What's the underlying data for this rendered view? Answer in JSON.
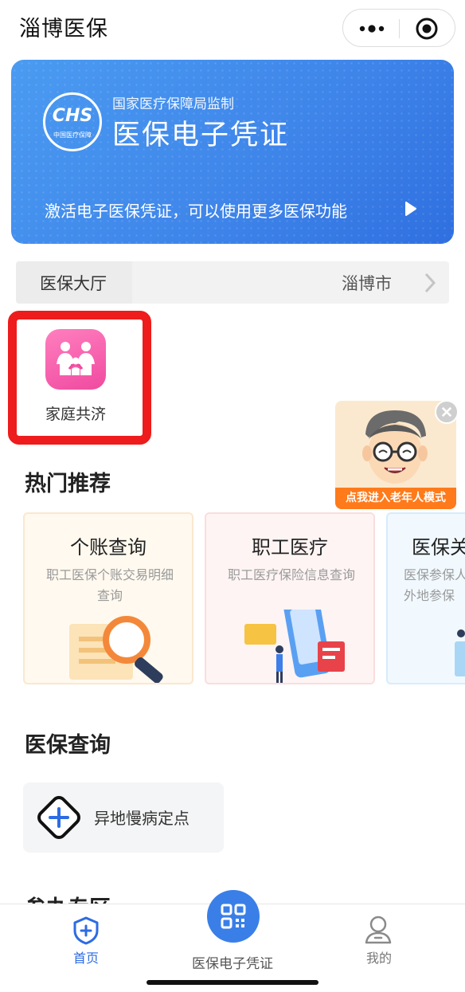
{
  "header": {
    "title": "淄博医保",
    "more_icon": "more-dots-icon",
    "target_icon": "record-target-icon"
  },
  "card": {
    "logo_text": "CHS",
    "logo_subtext": "中国医疗保障",
    "subtitle": "国家医疗保障局监制",
    "title": "医保电子凭证",
    "note": "激活电子医保凭证，可以使用更多医保功能",
    "accent": "#3f86ea"
  },
  "hall": {
    "label": "医保大厅",
    "city": "淄博市"
  },
  "family": {
    "label": "家庭共济",
    "icon": "family-icon",
    "highlight_color": "#ee1c1c"
  },
  "elder_mode": {
    "label": "点我进入老年人模式"
  },
  "hot": {
    "title": "热门推荐",
    "cards": [
      {
        "title": "个账查询",
        "desc": "职工医保个账交易明细查询"
      },
      {
        "title": "职工医疗",
        "desc": "职工医疗保险信息查询"
      },
      {
        "title": "医保关",
        "desc": "医保参保人理外地参保"
      }
    ]
  },
  "query": {
    "title": "医保查询",
    "items": [
      {
        "label": "异地慢病定点"
      }
    ]
  },
  "next_section": {
    "title": "参办专区"
  },
  "tabbar": {
    "home_label": "首页",
    "cert_label": "医保电子凭证",
    "me_label": "我的",
    "active_color": "#2d6be3"
  }
}
